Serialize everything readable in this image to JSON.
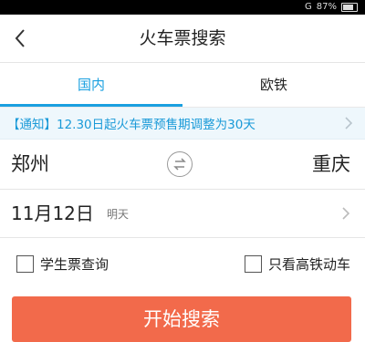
{
  "status_bar": {
    "network": "G",
    "battery_text": "87%"
  },
  "header": {
    "title": "火车票搜索",
    "back_icon": "chevron-left-icon"
  },
  "tabs": [
    {
      "label": "国内",
      "active": true
    },
    {
      "label": "欧铁",
      "active": false
    }
  ],
  "notice": {
    "text": "【通知】12.30日起火车票预售期调整为30天"
  },
  "stations": {
    "from": "郑州",
    "to": "重庆",
    "swap_icon": "swap-arrows-icon"
  },
  "date": {
    "value": "11月12日",
    "relative": "明天"
  },
  "options": {
    "student": "学生票查询",
    "high_speed_only": "只看高铁动车"
  },
  "actions": {
    "search_label": "开始搜索"
  },
  "colors": {
    "accent": "#1aa0e0",
    "search_button": "#f26a4b",
    "notice_bg": "#eef7fc"
  }
}
